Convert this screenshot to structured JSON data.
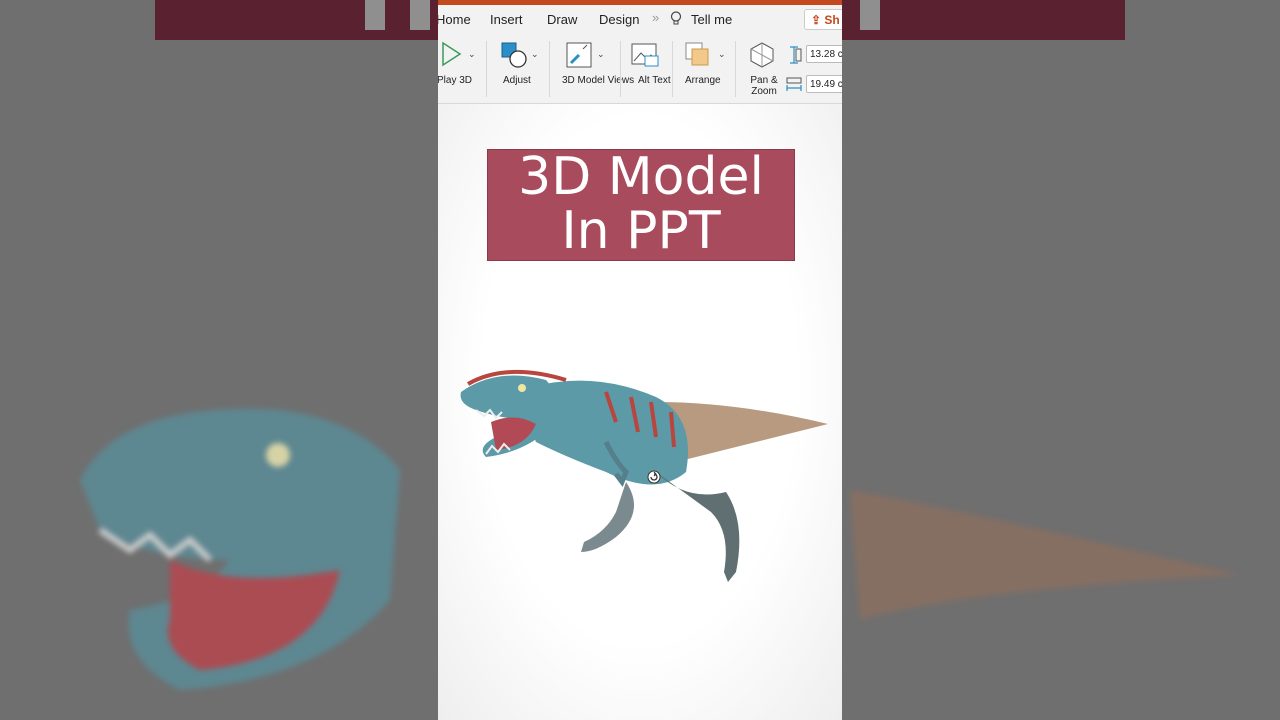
{
  "tabs": [
    "Home",
    "Insert",
    "Draw",
    "Design"
  ],
  "tell_me": "Tell me",
  "share_label": "Sh",
  "ribbon": {
    "play3d": "Play 3D",
    "adjust": "Adjust",
    "model_views": "3D Model Views",
    "alt_text": "Alt Text",
    "arrange": "Arrange",
    "pan_zoom": "Pan & Zoom",
    "height": "13.28 c",
    "width": "19.49 c"
  },
  "slide": {
    "title_line1": "3D Model",
    "title_line2": "In PPT"
  },
  "colors": {
    "accent": "#c4491f",
    "title_fill": "#a84b5c"
  }
}
